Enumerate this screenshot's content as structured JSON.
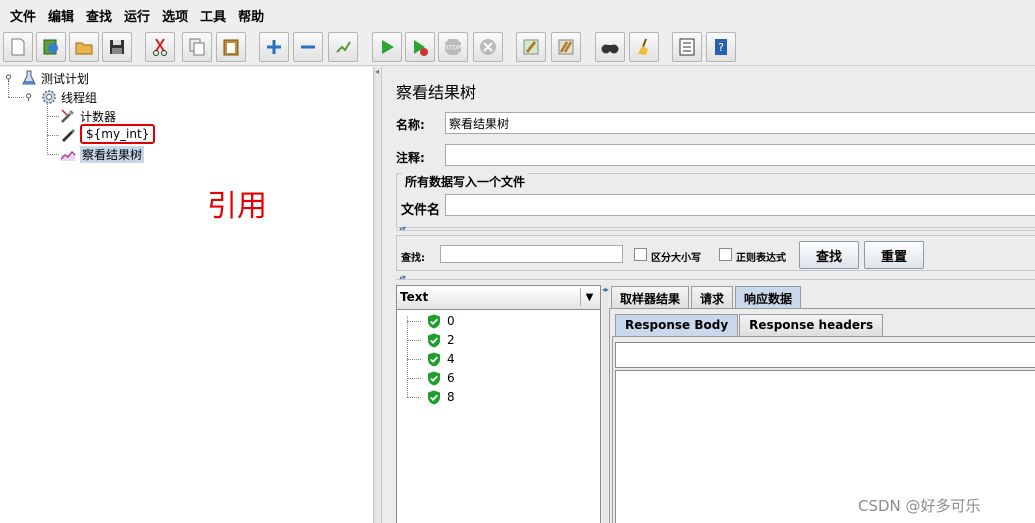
{
  "menu": [
    "文件",
    "编辑",
    "查找",
    "运行",
    "选项",
    "工具",
    "帮助"
  ],
  "toolbar_icons": [
    "new-icon",
    "templates-icon",
    "open-icon",
    "save-icon",
    "cut-icon",
    "copy-icon",
    "paste-icon",
    "expand-icon",
    "collapse-icon",
    "toggle-icon",
    "start-icon",
    "start-no-pause-icon",
    "stop-icon",
    "shutdown-icon",
    "clear-icon",
    "clear-all-icon",
    "search-icon",
    "reset-search-icon",
    "function-helper-icon",
    "help-icon"
  ],
  "tree": {
    "root": "测试计划",
    "thread_group": "线程组",
    "counter": "计数器",
    "var_ref": "${my_int}",
    "listener": "察看结果树"
  },
  "annotation": "引用",
  "panel": {
    "title": "察看结果树",
    "name_label": "名称:",
    "name_value": "察看结果树",
    "comment_label": "注释:",
    "comment_value": "",
    "file_group_title": "所有数据写入一个文件",
    "filename_label": "文件名",
    "filename_value": ""
  },
  "search": {
    "label": "查找:",
    "value": "",
    "case_sensitive": "区分大小写",
    "regex": "正则表达式",
    "find_button": "查找",
    "reset_button": "重置"
  },
  "results": {
    "renderer": "Text",
    "items": [
      "0",
      "2",
      "4",
      "6",
      "8"
    ],
    "status_color": "#1e9e2a"
  },
  "tabs": [
    "取样器结果",
    "请求",
    "响应数据"
  ],
  "subtabs": [
    "Response Body",
    "Response headers"
  ],
  "watermark": "CSDN @好多可乐"
}
